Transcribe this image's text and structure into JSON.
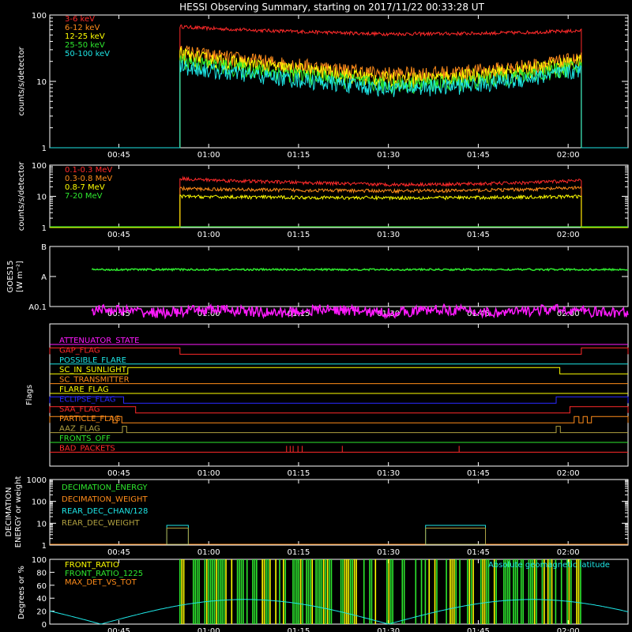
{
  "title": "HESSI Observing Summary, starting on 2017/11/22 00:33:28 UT",
  "time_axis": {
    "start_minutes": 33.47,
    "end_minutes": 130,
    "ticks": [
      {
        "label": "00:45",
        "minutes": 45
      },
      {
        "label": "01:00",
        "minutes": 60
      },
      {
        "label": "01:15",
        "minutes": 75
      },
      {
        "label": "01:30",
        "minutes": 90
      },
      {
        "label": "01:45",
        "minutes": 105
      },
      {
        "label": "02:00",
        "minutes": 120
      }
    ],
    "data_start_minutes": 55.2,
    "data_end_minutes": 122.2
  },
  "colors": {
    "red": "#ff2a2a",
    "orange": "#ff8c1a",
    "yellow": "#ffff00",
    "green": "#2ee82e",
    "cyan": "#1ee6e6",
    "magenta": "#ff1aff",
    "blue": "#2a2aff",
    "olive": "#b0a040",
    "white": "#ffffff"
  },
  "chart_data": [
    {
      "type": "line",
      "panel": "lightcurve",
      "ylabel": "counts/s/detector",
      "yscale": "log",
      "ylim": [
        1,
        100
      ],
      "ytick_labels": [
        "1",
        "10",
        "100"
      ],
      "series": [
        {
          "name": "3-6 keV",
          "color": "red",
          "level_start": 68,
          "level_mid": 52,
          "level_end": 58
        },
        {
          "name": "6-12 keV",
          "color": "orange",
          "level_start": 30,
          "level_mid": 13,
          "level_end": 22
        },
        {
          "name": "12-25 keV",
          "color": "yellow",
          "level_start": 26,
          "level_mid": 11,
          "level_end": 20
        },
        {
          "name": "25-50 keV",
          "color": "green",
          "level_start": 22,
          "level_mid": 9,
          "level_end": 17
        },
        {
          "name": "50-100 keV",
          "color": "cyan",
          "level_start": 18,
          "level_mid": 8,
          "level_end": 15
        }
      ]
    },
    {
      "type": "line",
      "panel": "lightcurve_high",
      "ylabel": "counts/s/detector",
      "yscale": "log",
      "ylim": [
        1,
        100
      ],
      "ytick_labels": [
        "1",
        "10",
        "100"
      ],
      "series": [
        {
          "name": "0.1-0.3 MeV",
          "color": "red",
          "level_start": 38,
          "level_mid": 24,
          "level_end": 32
        },
        {
          "name": "0.3-0.8 MeV",
          "color": "orange",
          "level_start": 18,
          "level_mid": 15,
          "level_end": 19
        },
        {
          "name": "0.8-7 MeV",
          "color": "yellow",
          "level_start": 10,
          "level_mid": 9,
          "level_end": 10
        },
        {
          "name": "7-20 MeV",
          "color": "green",
          "level_start": 1,
          "level_mid": 1,
          "level_end": 1
        }
      ]
    },
    {
      "type": "line",
      "panel": "goes",
      "ylabel": "GOES15",
      "ylabel_unit": "[W m⁻²]",
      "ytick_labels": [
        "A0.1",
        "A",
        "B"
      ],
      "ylim_log_decades": [
        -9,
        -7
      ],
      "series": [
        {
          "name": "",
          "color": "green",
          "level": 1.7e-08
        },
        {
          "name": "",
          "color": "magenta",
          "level": 7e-10
        }
      ]
    },
    {
      "type": "line",
      "panel": "flags",
      "ylabel": "Flags",
      "series": [
        {
          "name": "ATTENUATOR_STATE",
          "color": "magenta",
          "changes": []
        },
        {
          "name": "GAP_FLAG",
          "color": "red",
          "high_intervals": [
            [
              33.47,
              55.2
            ],
            [
              122.2,
              130
            ]
          ]
        },
        {
          "name": "POSSIBLE_FLARE",
          "color": "cyan",
          "changes": []
        },
        {
          "name": "SC_IN_SUNLIGHT",
          "color": "yellow",
          "high_intervals": [
            [
              46.5,
              118.6
            ]
          ]
        },
        {
          "name": "SC_TRANSMITTER",
          "color": "orange",
          "changes": []
        },
        {
          "name": "FLARE_FLAG",
          "color": "yellow",
          "changes": []
        },
        {
          "name": "ECLIPSE_FLAG",
          "color": "blue",
          "high_intervals": [
            [
              33.47,
              45.8
            ],
            [
              118.0,
              130
            ]
          ]
        },
        {
          "name": "SAA_FLAG",
          "color": "red",
          "high_intervals": [
            [
              33.47,
              47.8
            ],
            [
              120.3,
              130
            ]
          ]
        },
        {
          "name": "PARTICLE_FLAG",
          "color": "orange",
          "high_intervals": [
            [
              33.47,
              44.0
            ],
            [
              44.7,
              45.5
            ],
            [
              121.0,
              121.8
            ],
            [
              122.5,
              123.2
            ],
            [
              123.9,
              130
            ]
          ]
        },
        {
          "name": "AAZ_FLAG",
          "color": "olive",
          "high_intervals": [
            [
              45.6,
              46.3
            ],
            [
              118.0,
              118.7
            ]
          ]
        },
        {
          "name": "FRONTS_OFF",
          "color": "green",
          "changes": []
        },
        {
          "name": "BAD_PACKETS",
          "color": "red",
          "spikes": [
            73.0,
            73.6,
            74.1,
            74.9,
            75.6,
            82.3,
            101.8
          ]
        }
      ]
    },
    {
      "type": "line",
      "panel": "decimation",
      "ylabel": "DECIMATION ENERGY or weight",
      "yscale": "log",
      "ylim": [
        1,
        1000
      ],
      "ytick_labels": [
        "1",
        "10",
        "100",
        "1000"
      ],
      "series": [
        {
          "name": "DECIMATION_ENERGY",
          "color": "green",
          "level": 1
        },
        {
          "name": "DECIMATION_WEIGHT",
          "color": "orange",
          "level": 1
        },
        {
          "name": "REAR_DEC_CHAN/128",
          "color": "cyan",
          "boxes": [
            [
              53.0,
              56.6,
              8
            ],
            [
              96.2,
              106.2,
              8
            ]
          ]
        },
        {
          "name": "REAR_DEC_WEIGHT",
          "color": "olive",
          "boxes": [
            [
              53.0,
              56.6,
              6
            ],
            [
              96.2,
              106.2,
              6
            ]
          ]
        }
      ]
    },
    {
      "type": "line",
      "panel": "ratio",
      "ylabel": "Degrees or %",
      "ylim": [
        0,
        100
      ],
      "ytick_labels": [
        "0",
        "20",
        "40",
        "60",
        "80",
        "100"
      ],
      "annotation": "Absolute geomagnetic latitude",
      "series": [
        {
          "name": "FRONT_RATIO",
          "color": "yellow"
        },
        {
          "name": "FRONT_RATIO_1225",
          "color": "green"
        },
        {
          "name": "MAX_DET_VS_TOT",
          "color": "orange"
        },
        {
          "name": "Absolute geomagnetic latitude",
          "color": "cyan",
          "amplitude": 38,
          "period_minutes": 48
        }
      ]
    }
  ]
}
